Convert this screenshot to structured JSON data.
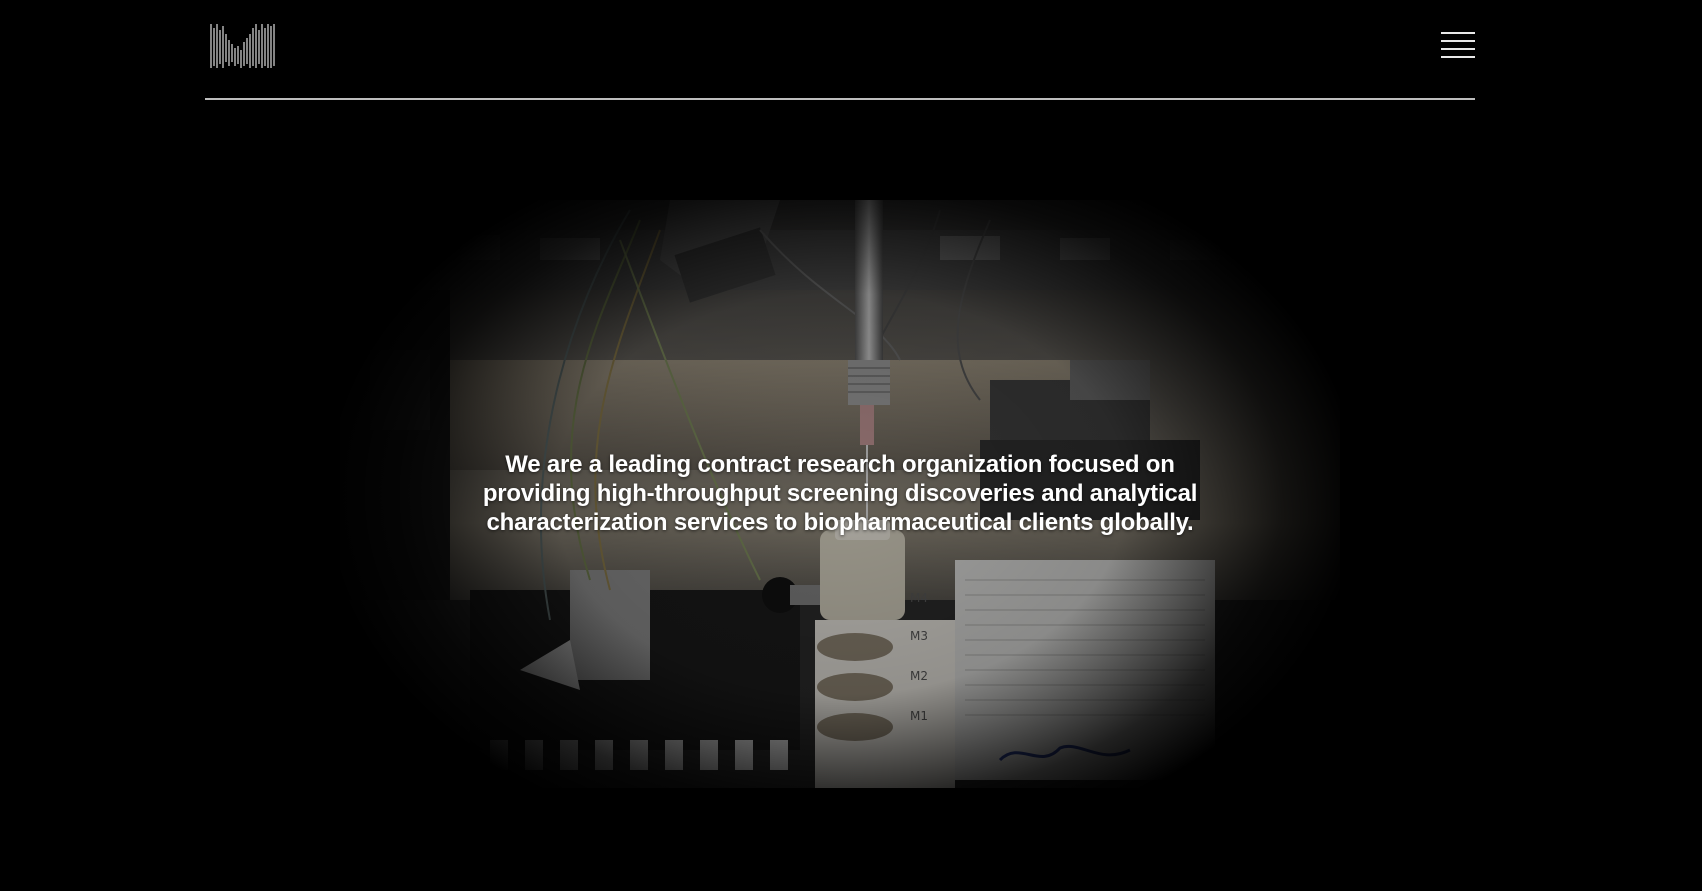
{
  "header": {
    "logo_icon": "waveform-logo-icon",
    "menu_icon": "hamburger-menu-icon"
  },
  "hero": {
    "image_subject": "lab-robotic-dispenser-photo",
    "headline": "We are a leading contract research organization focused on providing high-throughput screening discoveries and analytical characterization services to biopharmaceutical clients globally."
  },
  "colors": {
    "background": "#000000",
    "text": "#ffffff",
    "divider": "#bdbdbd"
  }
}
